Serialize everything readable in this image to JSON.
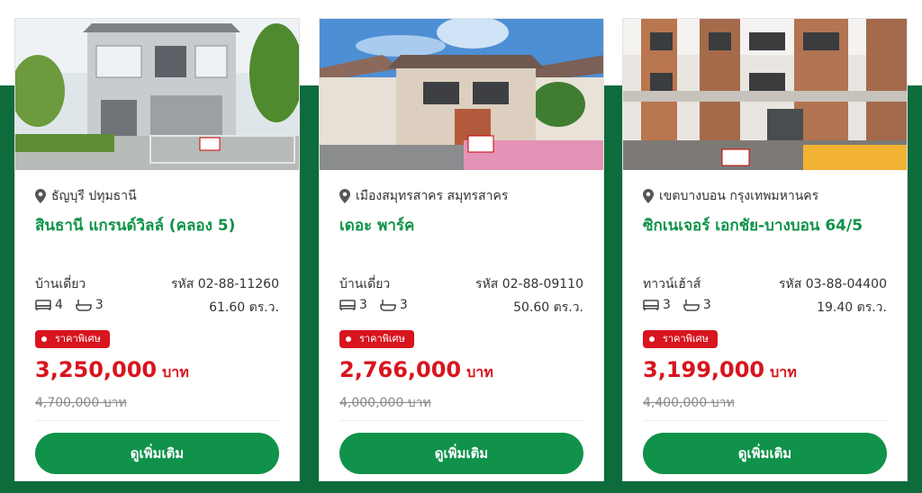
{
  "listings": [
    {
      "location": "ธัญบุรี ปทุมธานี",
      "title": "สินธานี แกรนด์วิลล์ (คลอง 5)",
      "type": "บ้านเดี่ยว",
      "code": "รหัส 02-88-11260",
      "bedrooms": "4",
      "bathrooms": "3",
      "area": "61.60 ตร.ว.",
      "badge": "ราคาพิเศษ",
      "price": "3,250,000",
      "price_unit": "บาท",
      "old_price": "4,700,000 บาท",
      "button": "ดูเพิ่มเติม"
    },
    {
      "location": "เมืองสมุทรสาคร สมุทรสาคร",
      "title": "เดอะ พาร์ค",
      "type": "บ้านเดี่ยว",
      "code": "รหัส 02-88-09110",
      "bedrooms": "3",
      "bathrooms": "3",
      "area": "50.60 ตร.ว.",
      "badge": "ราคาพิเศษ",
      "price": "2,766,000",
      "price_unit": "บาท",
      "old_price": "4,000,000 บาท",
      "button": "ดูเพิ่มเติม"
    },
    {
      "location": "เขตบางบอน กรุงเทพมหานคร",
      "title": "ซิกเนเจอร์ เอกชัย-บางบอน 64/5",
      "type": "ทาวน์เฮ้าส์",
      "code": "รหัส 03-88-04400",
      "bedrooms": "3",
      "bathrooms": "3",
      "area": "19.40 ตร.ว.",
      "badge": "ราคาพิเศษ",
      "price": "3,199,000",
      "price_unit": "บาท",
      "old_price": "4,400,000 บาท",
      "button": "ดูเพิ่มเติม"
    }
  ],
  "colors": {
    "brand_green": "#10924a",
    "band_green": "#0d6b3c",
    "price_red": "#d8141e"
  },
  "icons": [
    "map-pin-icon",
    "bed-icon",
    "bathtub-icon"
  ]
}
